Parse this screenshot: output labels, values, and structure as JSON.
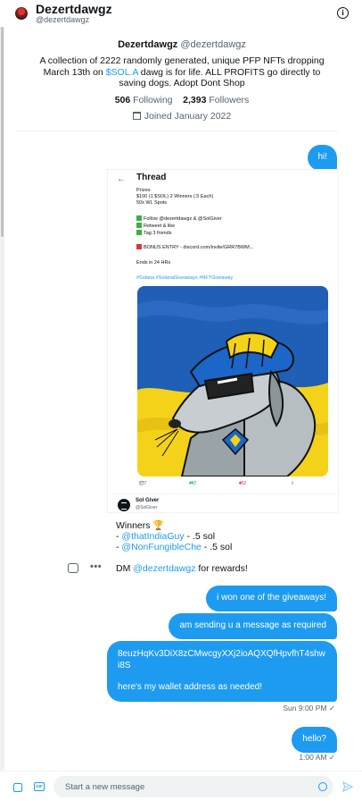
{
  "header": {
    "name": "Dezertdawgz",
    "handle": "@dezertdawgz",
    "info_icon": "info-icon",
    "info_glyph": "i"
  },
  "profile": {
    "name": "Dezertdawgz",
    "handle": "@dezertdawgz",
    "bio_before": "A collection of 2222 randomly generated, unique PFP NFTs dropping March 13th on ",
    "bio_link": "$SOL.A",
    "bio_after": " dawg is for life. ALL PROFITS go directly to saving dogs. Adopt Dont Shop",
    "following_count": "506",
    "following_label": "Following",
    "followers_count": "2,393",
    "followers_label": "Followers",
    "joined": "Joined January 2022"
  },
  "messages": {
    "hi": "hi!",
    "won": "i won one of the giveaways!",
    "sending": "am sending u a message as required",
    "wallet_address": "8euzHqKv3DiX8zCMwcgyXXj2ioAQXQfHpvfhT4shwi8S",
    "wallet_note": "here's my wallet address as needed!",
    "timestamp1": "Sun 9:00 PM ✓",
    "hello": "hello?",
    "timestamp2": "1:00 AM ✓"
  },
  "shared_tweet": {
    "back": "←",
    "thread_label": "Thread",
    "prizes": "Prizes:",
    "prize1": "$100 (1 $SOL) 2 Winners (.5 Each)",
    "prize2": "50x WL Spots",
    "req1": "Follow @dezertdawgz & @SolGiver",
    "req2": "Retweet & like",
    "req3": "Tag 3 friends",
    "bonus": "BONUS ENTRY - discord.com/invite/GRR7BWM...",
    "ends": "Ends in 24 HRs",
    "hashtags": "#Solana #SolanaGiveaways #NFTGiveaway",
    "replies": "377",
    "retweets": "442",
    "likes": "452",
    "reply_glyph": "◯",
    "retweet_glyph": "⇄",
    "like_glyph": "♥",
    "share_glyph": "⇪",
    "giver_name": "Sol Giver",
    "giver_handle": "@SolGiver",
    "winners": "Winners 🏆",
    "winner1_mention": "@thatIndiaGuy",
    "winner1_amount": " - .5 sol",
    "winner2_mention": "@NonFungibleChe",
    "winner2_amount": " - .5 sol",
    "dm_prefix": "DM ",
    "dm_mention": "@dezertdawgz",
    "dm_suffix": " for rewards!"
  },
  "composer": {
    "placeholder": "Start a new message",
    "gif_label": "GIF"
  },
  "more_glyph": "•••",
  "colors": {
    "accent": "#1d9bf0",
    "text": "#0f1419",
    "muted": "#536471",
    "flag_blue": "#1f5fb5",
    "flag_yellow": "#f4d21a"
  }
}
